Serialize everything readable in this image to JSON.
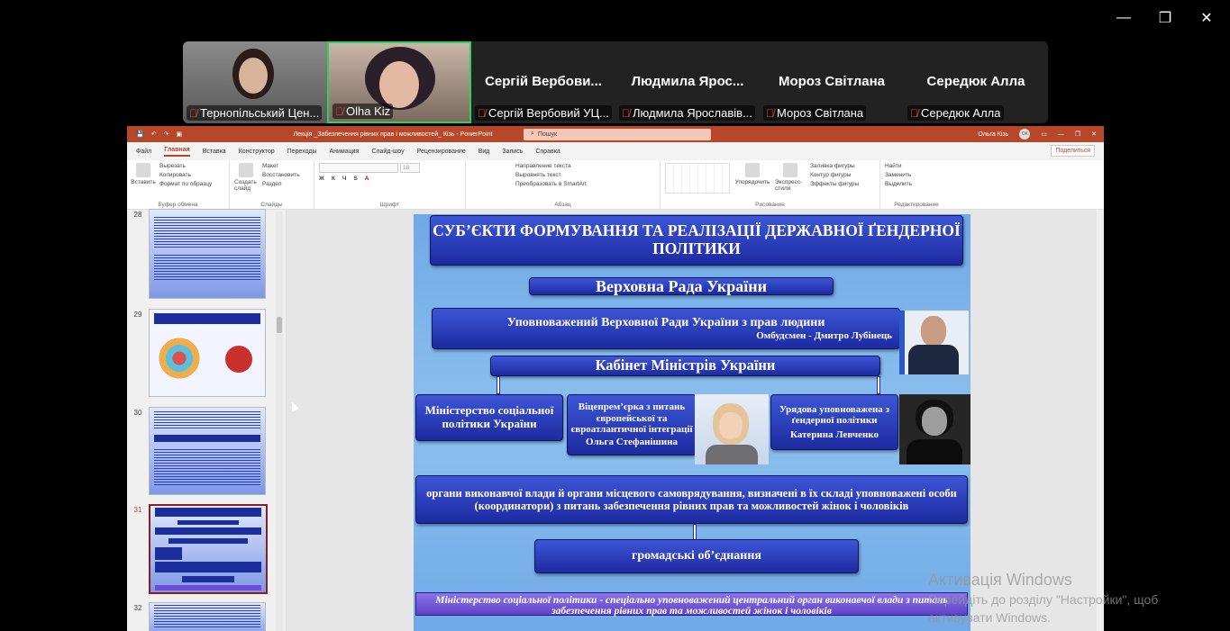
{
  "window_controls": {
    "minimize": "—",
    "restore": "❐",
    "close": "✕"
  },
  "participants": [
    {
      "name": "Тернопільський Цен...",
      "video": true,
      "muted": true
    },
    {
      "name": "Olha Kiz",
      "video": true,
      "muted": true,
      "speaking": true
    },
    {
      "display": "Сергій  Вербови...",
      "name": "Сергій Вербовий УЦ...",
      "muted": true
    },
    {
      "display": "Людмила  Ярос...",
      "name": "Людмила Ярославів...",
      "muted": true
    },
    {
      "display": "Мороз Світлана",
      "name": "Мороз Світлана",
      "muted": true
    },
    {
      "display": "Середюк Алла",
      "name": "Середюк Алла",
      "muted": true
    }
  ],
  "ppt": {
    "title": "Лекція _Забезпечення рівних прав і можливостей_ Кізь  -  PowerPoint",
    "search_placeholder": "Пошук",
    "user": "Ольга Кізь",
    "user_initials": "ОК",
    "tabs": [
      "Файл",
      "Главная",
      "Вставка",
      "Конструктор",
      "Переходы",
      "Анимация",
      "Слайд-шоу",
      "Рецензирование",
      "Вид",
      "Запись",
      "Справка"
    ],
    "active_tab": "Главная",
    "share": "Поделиться",
    "ribbon": {
      "clipboard": {
        "paste": "Вставить",
        "cut": "Вырезать",
        "copy": "Копировать",
        "format": "Формат по образцу",
        "caption": "Буфер обмена"
      },
      "slides": {
        "new": "Создать слайд",
        "layout": "Макет",
        "reset": "Восстановить",
        "section": "Раздел",
        "caption": "Слайды"
      },
      "font": {
        "size": "18",
        "caption": "Шрифт"
      },
      "paragraph": {
        "direction": "Направление текста",
        "align": "Выровнять текст",
        "smartart": "Преобразовать в SmartArt",
        "caption": "Абзац"
      },
      "drawing": {
        "arrange": "Упорядочить",
        "styles": "Экспресс-стили",
        "fill": "Заливка фигуры",
        "outline": "Контур фигуры",
        "effects": "Эффекты фигуры",
        "caption": "Рисование"
      },
      "editing": {
        "find": "Найти",
        "replace": "Заменить",
        "select": "Выделить",
        "caption": "Редактирование"
      }
    },
    "thumbnails": [
      {
        "num": "28"
      },
      {
        "num": "29"
      },
      {
        "num": "30"
      },
      {
        "num": "31",
        "selected": true
      },
      {
        "num": "32"
      }
    ]
  },
  "slide": {
    "title": "СУБ’ЄКТИ ФОРМУВАННЯ ТА РЕАЛІЗАЦІЇ ДЕРЖАВНОЇ ҐЕНДЕРНОЇ ПОЛІТИКИ",
    "rada": "Верховна Рада України",
    "ombudsman": "Уповноважений Верховної  Ради України з прав людини",
    "ombudsman_name": "Омбудсмен - Дмитро Лубінець",
    "cabinet": "Кабінет Міністрів України",
    "ministry": "Міністерство соціальної політики України",
    "vice_pm": "Віцепрем’єрка з питань європейської та євроатлантичної інтеграції",
    "vice_pm_name": "Ольга Стефанішина",
    "commissioner": "Урядова уповноважена з ґендерної  політики",
    "commissioner_name": "Катерина Левченко",
    "authorities": "органи виконавчої влади й органи місцевого самоврядування, визначені в їх складі уповноважені особи (координатори) з питань забезпечення рівних прав та можливостей жінок і чоловіків",
    "ngo": "громадські об’єднання",
    "footer": "Міністерство  соціальної політики - спеціально уповноважений центральний орган виконавчої влади з питань забезпечення рівних прав та можливостей жінок і чоловіків"
  },
  "watermark": {
    "line1": "Активація Windows",
    "line2": "Перейдіть до розділу \"Настройки\", щоб",
    "line3": "активувати Windows."
  }
}
